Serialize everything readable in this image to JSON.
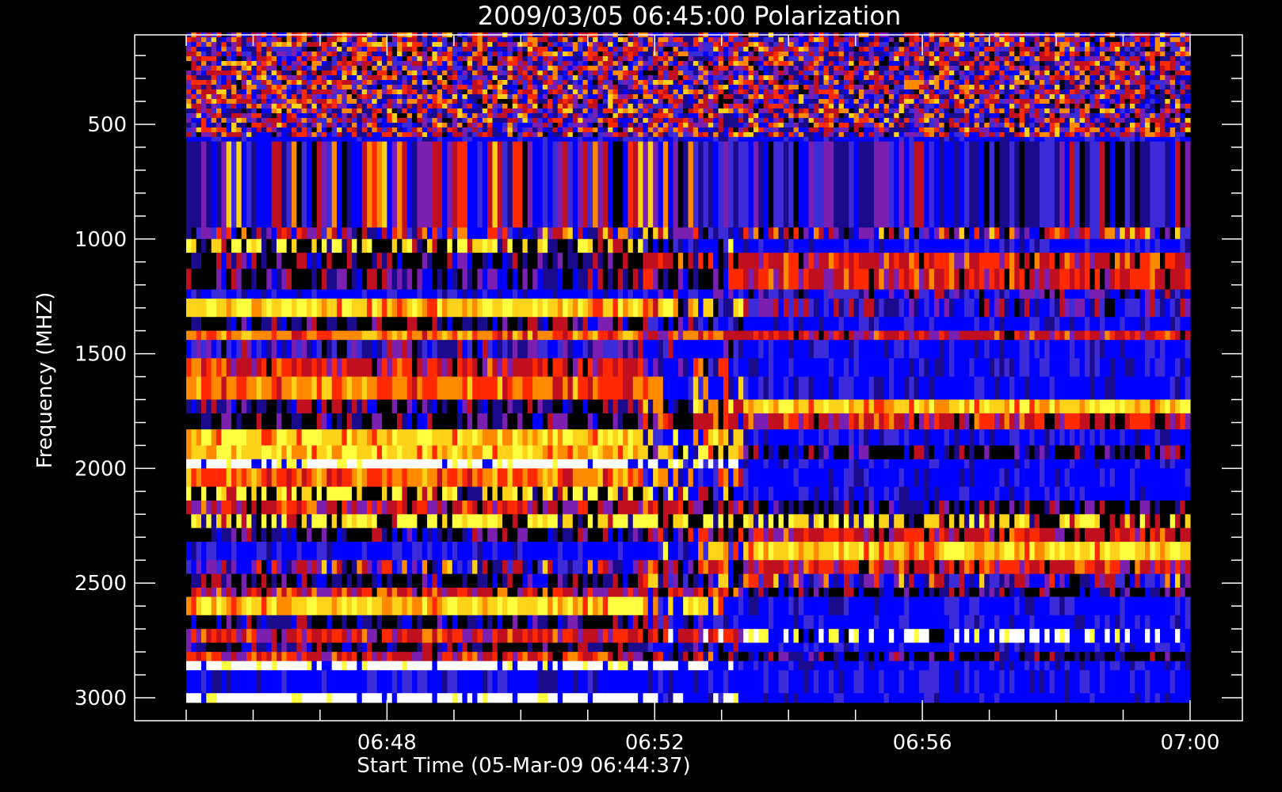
{
  "chart_data": {
    "type": "heatmap",
    "title": "2009/03/05 06:45:00 Polarization",
    "xlabel": "Start Time (05-Mar-09 06:44:37)",
    "ylabel": "Frequency (MHZ)",
    "x_ticks": [
      "06:48",
      "06:52",
      "06:56",
      "07:00"
    ],
    "y_ticks": [
      500,
      1000,
      1500,
      2000,
      2500,
      3000
    ],
    "ylim": [
      110,
      3100
    ],
    "data_time_range": [
      "06:45:00",
      "07:00:00"
    ],
    "data_freq_range": [
      100,
      3020
    ],
    "y_inverted": true,
    "colors": {
      "background": "#000000",
      "axes": "#ffffff",
      "palette": [
        "#000000",
        "#1a0a8c",
        "#0000ff",
        "#3b2bd9",
        "#7a1fb0",
        "#c01020",
        "#ff2a00",
        "#ff8a00",
        "#ffd21a",
        "#ffff40",
        "#ffffff"
      ]
    },
    "grid": false,
    "legend": "none",
    "bands": [
      {
        "f0": 100,
        "f1": 555,
        "early": "noise",
        "late": "noise"
      },
      {
        "f0": 555,
        "f1": 575,
        "early": "blue",
        "late": "blue"
      },
      {
        "f0": 575,
        "f1": 950,
        "early": "mixed",
        "late": "purple"
      },
      {
        "f0": 950,
        "f1": 1000,
        "early": "mixed",
        "late": "mixed"
      },
      {
        "f0": 1000,
        "f1": 1060,
        "early": "yellow-streak",
        "late": "blue"
      },
      {
        "f0": 1060,
        "f1": 1130,
        "early": "dark",
        "late": "red"
      },
      {
        "f0": 1130,
        "f1": 1220,
        "early": "dark",
        "late": "red"
      },
      {
        "f0": 1220,
        "f1": 1260,
        "early": "blue",
        "late": "purple"
      },
      {
        "f0": 1260,
        "f1": 1340,
        "early": "yellow",
        "late": "purple"
      },
      {
        "f0": 1340,
        "f1": 1400,
        "early": "dark",
        "late": "blue"
      },
      {
        "f0": 1400,
        "f1": 1440,
        "early": "orange",
        "late": "red"
      },
      {
        "f0": 1440,
        "f1": 1520,
        "early": "purple",
        "late": "blue"
      },
      {
        "f0": 1520,
        "f1": 1600,
        "early": "red",
        "late": "blue"
      },
      {
        "f0": 1600,
        "f1": 1700,
        "early": "orange",
        "late": "blue"
      },
      {
        "f0": 1700,
        "f1": 1760,
        "early": "dark",
        "late": "yellow"
      },
      {
        "f0": 1760,
        "f1": 1830,
        "early": "dark",
        "late": "red"
      },
      {
        "f0": 1830,
        "f1": 1900,
        "early": "yellow",
        "late": "blue"
      },
      {
        "f0": 1900,
        "f1": 1960,
        "early": "yellow",
        "late": "dark"
      },
      {
        "f0": 1960,
        "f1": 2000,
        "early": "white",
        "late": "blue"
      },
      {
        "f0": 2000,
        "f1": 2080,
        "early": "orange",
        "late": "blue"
      },
      {
        "f0": 2080,
        "f1": 2140,
        "early": "yellow-streak",
        "late": "blue"
      },
      {
        "f0": 2140,
        "f1": 2200,
        "early": "red",
        "late": "dark"
      },
      {
        "f0": 2200,
        "f1": 2260,
        "early": "yellow-streak",
        "late": "yellow-streak"
      },
      {
        "f0": 2260,
        "f1": 2320,
        "early": "dark",
        "late": "red"
      },
      {
        "f0": 2320,
        "f1": 2400,
        "early": "blue",
        "late": "yellow"
      },
      {
        "f0": 2400,
        "f1": 2460,
        "early": "mixed",
        "late": "red"
      },
      {
        "f0": 2460,
        "f1": 2520,
        "early": "dark",
        "late": "mixed"
      },
      {
        "f0": 2520,
        "f1": 2560,
        "early": "red",
        "late": "dark"
      },
      {
        "f0": 2560,
        "f1": 2640,
        "early": "yellow",
        "late": "blue"
      },
      {
        "f0": 2640,
        "f1": 2700,
        "early": "dark",
        "late": "blue"
      },
      {
        "f0": 2700,
        "f1": 2760,
        "early": "red",
        "late": "white-streak"
      },
      {
        "f0": 2760,
        "f1": 2800,
        "early": "dark",
        "late": "blue"
      },
      {
        "f0": 2800,
        "f1": 2840,
        "early": "red",
        "late": "dark"
      },
      {
        "f0": 2840,
        "f1": 2880,
        "early": "white",
        "late": "blue"
      },
      {
        "f0": 2880,
        "f1": 2980,
        "early": "blue",
        "late": "blue"
      },
      {
        "f0": 2980,
        "f1": 3020,
        "early": "white",
        "late": "blue"
      }
    ]
  }
}
